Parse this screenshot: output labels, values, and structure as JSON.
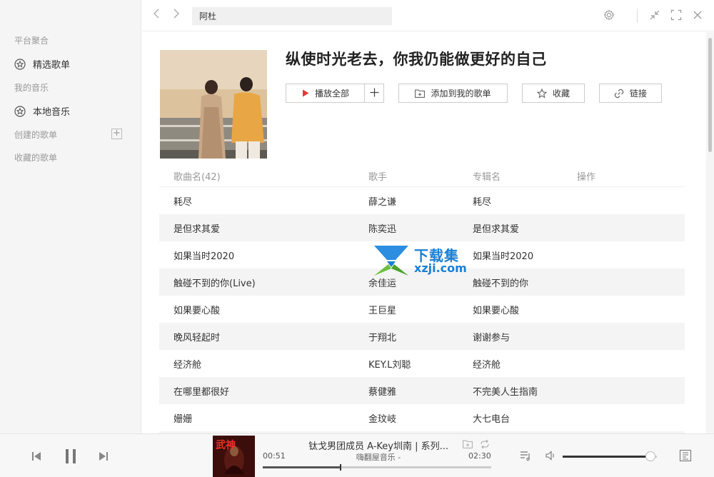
{
  "sidebar": {
    "platform_section": "平台聚合",
    "featured_playlists": "精选歌单",
    "my_music_section": "我的音乐",
    "local_music": "本地音乐",
    "created_playlists": "创建的歌单",
    "collected_playlists": "收藏的歌单"
  },
  "search": {
    "value": "阿杜"
  },
  "playlist": {
    "title": "纵使时光老去，你我仍能做更好的自己",
    "play_all": "播放全部",
    "add_to_my_playlist": "添加到我的歌单",
    "favorite": "收藏",
    "link": "链接"
  },
  "table": {
    "headers": {
      "song": "歌曲名(42)",
      "artist": "歌手",
      "album": "专辑名",
      "action": "操作"
    },
    "rows": [
      {
        "song": "耗尽",
        "artist": "薛之谦",
        "album": "耗尽"
      },
      {
        "song": "是但求其爱",
        "artist": "陈奕迅",
        "album": "是但求其爱"
      },
      {
        "song": "如果当时2020",
        "artist": "",
        "album": "如果当时2020"
      },
      {
        "song": "触碰不到的你(Live)",
        "artist": "余佳运",
        "album": "触碰不到的你"
      },
      {
        "song": "如果要心酸",
        "artist": "王巨星",
        "album": "如果要心酸"
      },
      {
        "song": "晚风轻起时",
        "artist": "于翔北",
        "album": "谢谢参与"
      },
      {
        "song": "经济舱",
        "artist": "KEY.L刘聪",
        "album": "经济舱"
      },
      {
        "song": "在哪里都很好",
        "artist": "蔡健雅",
        "album": "不完美人生指南"
      },
      {
        "song": "姗姗",
        "artist": "金玟岐",
        "album": "大七电台"
      }
    ]
  },
  "watermark": {
    "line1": "下载集",
    "line2": "xzji.com"
  },
  "player": {
    "title": "钛戈男团成员 A-Key圳南 | 系列...",
    "subtitle": "嗨翻屋音乐 -",
    "current_time": "00:51",
    "total_time": "02:30",
    "progress": 0.34,
    "volume": 0.93,
    "cover_text": "武神"
  },
  "colors": {
    "play_red": "#e53935",
    "accent_blue": "#1a7fd4"
  }
}
